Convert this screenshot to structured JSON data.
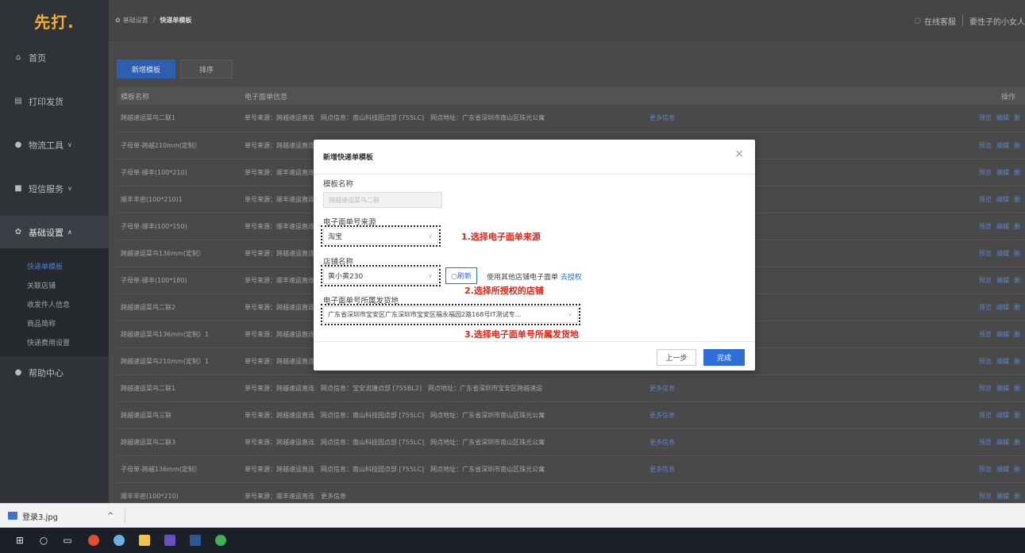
{
  "app": {
    "logo_text": "先打."
  },
  "sidebar": {
    "items": [
      {
        "label": "首页",
        "icon": "home-icon"
      },
      {
        "label": "打印发货",
        "icon": "printer-icon"
      },
      {
        "label": "物流工具",
        "icon": "gear-icon"
      },
      {
        "label": "短信服务",
        "icon": "sms-icon"
      },
      {
        "label": "基础设置",
        "icon": "settings-icon"
      },
      {
        "label": "帮助中心",
        "icon": "help-icon"
      }
    ],
    "sub_items": [
      "快递单模板",
      "关联店铺",
      "收发件人信息",
      "商品简称",
      "快递费用设置"
    ]
  },
  "header": {
    "breadcrumb_root": "基础设置",
    "breadcrumb_sep": "/",
    "breadcrumb_current": "快递单模板",
    "service_label": "在线客服",
    "user_label": "要性子的小女人"
  },
  "toolbar": {
    "new_label": "新增模板",
    "sort_label": "排序"
  },
  "table": {
    "headers": [
      "模板名称",
      "电子面单信息",
      "",
      "操作"
    ],
    "rows": [
      {
        "name": "跨越速运菜鸟二联1",
        "info": "单号来源：跨越速运直连　网点信息：南山科技园点部 [755LC]　网点地址：广东省深圳市南山区珠光公寓",
        "more": "更多信息"
      },
      {
        "name": "子母单-跨越210mm(定制）",
        "info": "单号来源：跨越速运直连",
        "more": ""
      },
      {
        "name": "子母单-顺丰(100*210)",
        "info": "单号来源：顺丰速运直连",
        "more": ""
      },
      {
        "name": "顺丰丰密(100*210)1",
        "info": "单号来源：顺丰速运直连",
        "more": ""
      },
      {
        "name": "子母单-顺丰(100*150)",
        "info": "单号来源：顺丰速运直连",
        "more": ""
      },
      {
        "name": "跨越速运菜鸟136mm(定制）",
        "info": "单号来源：跨越速运直连",
        "more": ""
      },
      {
        "name": "子母单-顺丰(100*180)",
        "info": "单号来源：顺丰速运直连",
        "more": ""
      },
      {
        "name": "跨越速运菜鸟二联2",
        "info": "单号来源：跨越速运直连",
        "more": ""
      },
      {
        "name": "跨越速运菜鸟136mm(定制）1",
        "info": "单号来源：跨越速运直连",
        "more": ""
      },
      {
        "name": "跨越速运菜鸟210mm(定制）1",
        "info": "单号来源：跨越速运直连",
        "more": ""
      },
      {
        "name": "跨越速运菜鸟二联1",
        "info": "单号来源：跨越速运直连　网点信息：宝安流塘点部 [755BL2]　网点地址：广东省深圳市宝安区跨越速运",
        "more": "更多信息"
      },
      {
        "name": "跨越速运菜鸟三联",
        "info": "单号来源：跨越速运直连　网点信息：南山科技园点部 [755LC]　网点地址：广东省深圳市南山区珠光公寓",
        "more": "更多信息"
      },
      {
        "name": "跨越速运菜鸟二联3",
        "info": "单号来源：跨越速运直连　网点信息：南山科技园点部 [755LC]　网点地址：广东省深圳市南山区珠光公寓",
        "more": "更多信息"
      },
      {
        "name": "子母单-跨越136mm(定制）",
        "info": "单号来源：跨越速运直连　网点信息：南山科技园点部 [755LC]　网点地址：广东省深圳市南山区珠光公寓",
        "more": "更多信息"
      },
      {
        "name": "顺丰丰密(100*210)",
        "info": "单号来源：顺丰速运直连　更多信息",
        "more": ""
      }
    ],
    "ops": [
      "预览",
      "编辑",
      "删"
    ]
  },
  "modal": {
    "title": "新增快递单模板",
    "close_icon": "close-icon",
    "name_label": "模板名称",
    "name_placeholder": "跨越速运菜鸟二联",
    "source_label": "电子面单号来源",
    "source_value": "淘宝",
    "shop_label": "店铺名称",
    "shop_value": "黄小黄230",
    "refresh_label": "○刷新",
    "auth_text": "使用其他店铺电子面单",
    "auth_link": "去授权",
    "address_label": "电子面单号所属发货地",
    "address_value": "广东省深圳市宝安区广东深圳市宝安区福永福园2路168号IT测试专...",
    "hint1": "1.选择电子面单来源",
    "hint2": "2.选择所授权的店铺",
    "hint3": "3.选择电子面单号所属发货地",
    "prev_label": "上一步",
    "done_label": "完成"
  },
  "download_bar": {
    "file_name": "登录3.jpg",
    "chevron": "^"
  },
  "colors": {
    "primary": "#2d6fd6",
    "hint_red": "#e0261a",
    "sidebar_bg": "#2f3237"
  }
}
